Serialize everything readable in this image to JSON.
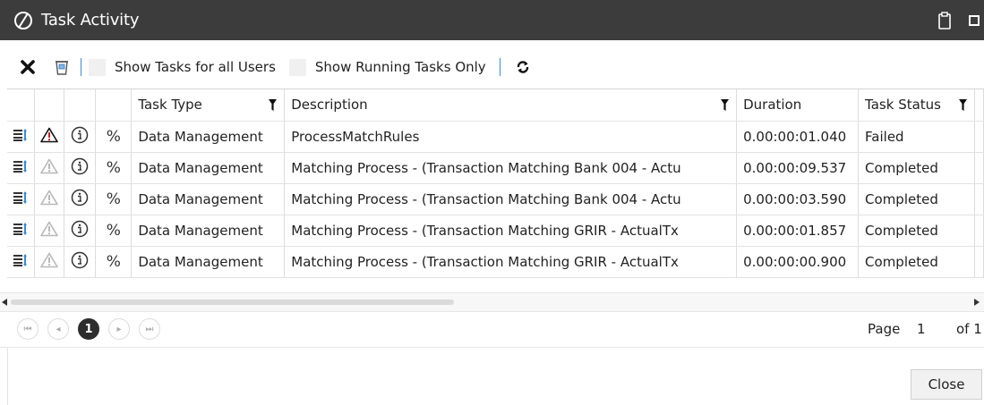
{
  "window": {
    "title": "Task Activity"
  },
  "toolbar": {
    "show_all_users_label": "Show Tasks for all Users",
    "show_running_only_label": "Show Running Tasks Only"
  },
  "grid": {
    "columns": [
      "Task Type",
      "Description",
      "Duration",
      "Task Status"
    ],
    "rows": [
      {
        "task_type": "Data Management",
        "description": "ProcessMatchRules",
        "duration": "0.00:00:01.040",
        "status": "Failed",
        "error": true
      },
      {
        "task_type": "Data Management",
        "description": "Matching Process - (Transaction Matching Bank 004 - Actu",
        "duration": "0.00:00:09.537",
        "status": "Completed",
        "error": false
      },
      {
        "task_type": "Data Management",
        "description": "Matching Process - (Transaction Matching Bank 004 - Actu",
        "duration": "0.00:00:03.590",
        "status": "Completed",
        "error": false
      },
      {
        "task_type": "Data Management",
        "description": "Matching Process - (Transaction Matching GRIR - ActualTx",
        "duration": "0.00:00:01.857",
        "status": "Completed",
        "error": false
      },
      {
        "task_type": "Data Management",
        "description": "Matching Process - (Transaction Matching GRIR - ActualTx",
        "duration": "0.00:00:00.900",
        "status": "Completed",
        "error": false
      }
    ],
    "percent_symbol": "%"
  },
  "pager": {
    "current_page": "1",
    "page_label": "Page",
    "page_value": "1",
    "of_label": "of 1"
  },
  "footer": {
    "close_label": "Close"
  },
  "colors": {
    "titlebar": "#3c3c3c",
    "error_red": "#cc1f1f",
    "warning_outline": "#b8b8b8",
    "accent_blue": "#3a8bd8"
  },
  "icons": [
    "onestream-logo-icon",
    "clipboard-icon",
    "maximize-icon",
    "close-icon",
    "delete-x-icon",
    "clear-log-icon",
    "refresh-icon",
    "details-icon",
    "warning-icon",
    "info-icon",
    "percent-icon",
    "filter-icon"
  ]
}
